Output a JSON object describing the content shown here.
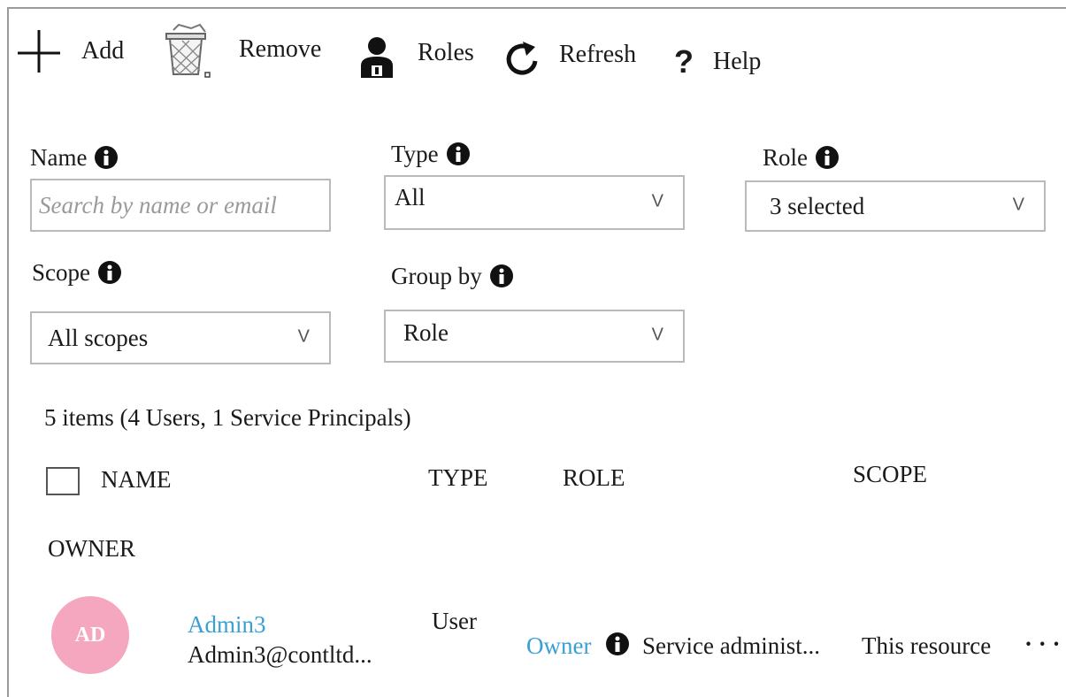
{
  "toolbar": {
    "add_label": "Add",
    "remove_label": "Remove",
    "roles_label": "Roles",
    "refresh_label": "Refresh",
    "help_label": "Help",
    "help_glyph": "?"
  },
  "filters": {
    "name": {
      "label": "Name",
      "placeholder": "Search by name or email"
    },
    "type": {
      "label": "Type",
      "value": "All"
    },
    "role": {
      "label": "Role",
      "value": "3 selected"
    },
    "scope": {
      "label": "Scope",
      "value": "All scopes"
    },
    "group_by": {
      "label": "Group by",
      "value": "Role"
    },
    "chevron": "V"
  },
  "summary": "5 items (4 Users, 1 Service Principals)",
  "table": {
    "columns": [
      "NAME",
      "TYPE",
      "ROLE",
      "SCOPE"
    ],
    "group_header": "OWNER",
    "rows": [
      {
        "avatar_initials": "AD",
        "name": "Admin3",
        "email": "Admin3@contltd...",
        "type": "User",
        "role": "Owner",
        "role_detail": "Service administ...",
        "scope": "This resource",
        "more": "· · ·"
      }
    ]
  },
  "icons": [
    "plus-icon",
    "trash-icon",
    "user-roles-icon",
    "refresh-icon",
    "help-icon",
    "info-icon",
    "chevron-down-icon"
  ],
  "colors": {
    "link": "#39a0d4",
    "avatar_bg": "#f4a7bf",
    "border": "#b9b9b9"
  }
}
